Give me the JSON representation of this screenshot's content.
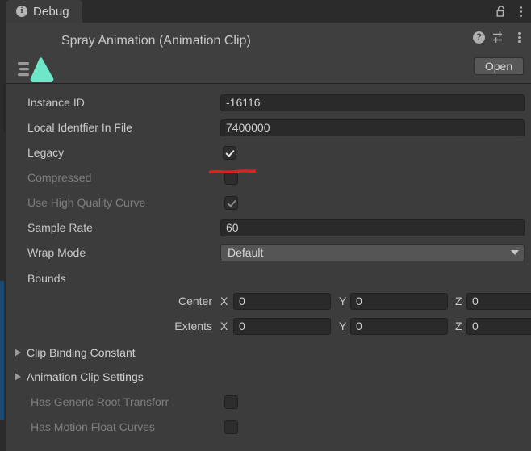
{
  "window": {
    "tab_label": "Debug",
    "tab_icon": "info-icon",
    "lock_icon": "unlock-icon",
    "tab_menu_icon": "kebab-menu-icon"
  },
  "object_header": {
    "title": "Spray Animation (Animation Clip)",
    "icon": "animation-clip-icon",
    "help_icon": "help-icon",
    "preset_icon": "preset-settings-icon",
    "menu_icon": "kebab-menu-icon",
    "open_label": "Open"
  },
  "properties": [
    {
      "label": "Instance ID",
      "type": "text",
      "value": "-16116",
      "disabled": false
    },
    {
      "label": "Local Identfier In File",
      "type": "text",
      "value": "7400000",
      "disabled": false
    },
    {
      "label": "Legacy",
      "type": "checkbox",
      "checked": true,
      "disabled": false,
      "annotated": true
    },
    {
      "label": "Compressed",
      "type": "checkbox",
      "checked": false,
      "disabled": true
    },
    {
      "label": "Use High Quality Curve",
      "type": "checkbox",
      "checked": true,
      "disabled": true
    },
    {
      "label": "Sample Rate",
      "type": "text",
      "value": "60",
      "disabled": false
    },
    {
      "label": "Wrap Mode",
      "type": "dropdown",
      "value": "Default",
      "disabled": false
    }
  ],
  "bounds": {
    "label": "Bounds",
    "rows": [
      {
        "label": "Center",
        "x_axis": "X",
        "x": "0",
        "y_axis": "Y",
        "y": "0",
        "z_axis": "Z",
        "z": "0"
      },
      {
        "label": "Extents",
        "x_axis": "X",
        "x": "0",
        "y_axis": "Y",
        "y": "0",
        "z_axis": "Z",
        "z": "0"
      }
    ]
  },
  "foldouts": [
    {
      "label": "Clip Binding Constant",
      "expanded": false
    },
    {
      "label": "Animation Clip Settings",
      "expanded": false
    }
  ],
  "trailing_properties": [
    {
      "label": "Has Generic Root Transforr",
      "checked": false,
      "disabled": true
    },
    {
      "label": "Has Motion Float Curves",
      "checked": false,
      "disabled": true
    }
  ],
  "colors": {
    "panel_bg": "#3c3c3c",
    "header_bg": "#3f3f3f",
    "tabstrip_bg": "#2b2b2b",
    "field_bg": "#2a2a2a",
    "dropdown_bg": "#555555",
    "clip_icon": "#6ee7c8",
    "annotation": "#e02020",
    "scroll_accent": "#184a73",
    "text": "#c8c8c8",
    "text_disabled": "#7e7e7e"
  }
}
